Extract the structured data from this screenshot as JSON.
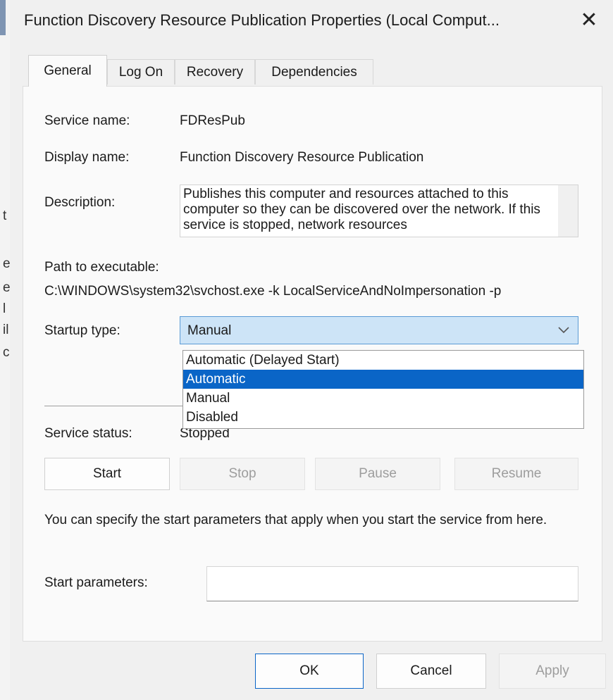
{
  "window": {
    "title": "Function Discovery Resource Publication Properties (Local Comput...",
    "close_glyph": "✕"
  },
  "background_chars": [
    "t",
    "e",
    "e",
    "l",
    "il",
    "c"
  ],
  "tabs": [
    {
      "label": "General",
      "active": true
    },
    {
      "label": "Log On",
      "active": false
    },
    {
      "label": "Recovery",
      "active": false
    },
    {
      "label": "Dependencies",
      "active": false
    }
  ],
  "general": {
    "service_name_label": "Service name:",
    "service_name": "FDResPub",
    "display_name_label": "Display name:",
    "display_name": "Function Discovery Resource Publication",
    "description_label": "Description:",
    "description": "Publishes this computer and resources attached to this computer so they can be discovered over the network.  If this service is stopped, network resources",
    "path_label": "Path to executable:",
    "path": "C:\\WINDOWS\\system32\\svchost.exe -k LocalServiceAndNoImpersonation -p",
    "startup_type_label": "Startup type:",
    "startup_type_value": "Manual",
    "startup_options": [
      "Automatic (Delayed Start)",
      "Automatic",
      "Manual",
      "Disabled"
    ],
    "startup_highlighted": "Automatic",
    "service_status_label": "Service status:",
    "service_status": "Stopped",
    "buttons": {
      "start": "Start",
      "stop": "Stop",
      "pause": "Pause",
      "resume": "Resume"
    },
    "help_text": "You can specify the start parameters that apply when you start the service from here.",
    "start_params_label": "Start parameters:",
    "start_params_value": ""
  },
  "footer": {
    "ok": "OK",
    "cancel": "Cancel",
    "apply": "Apply"
  },
  "colors": {
    "selection": "#0a65c7",
    "combo_bg": "#cde4f7",
    "dialog_bg": "#f0f0f0"
  },
  "icons": {
    "close": "close-icon",
    "chevron": "chevron-down-icon"
  }
}
